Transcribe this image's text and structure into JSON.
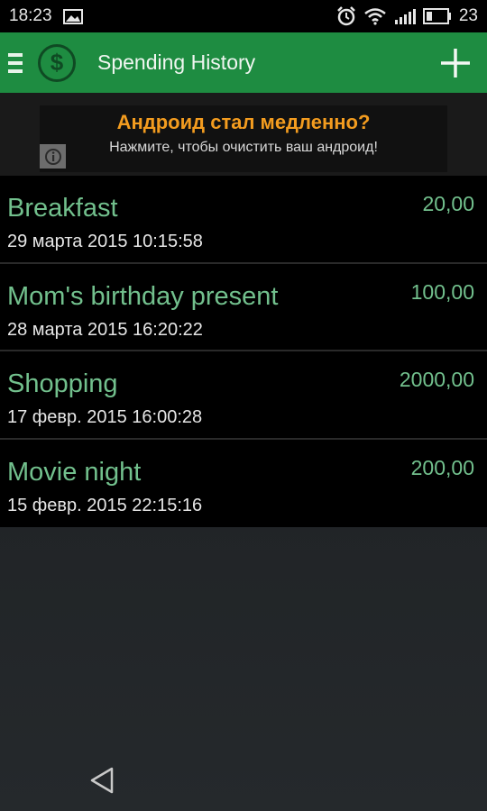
{
  "status_bar": {
    "time": "18:23",
    "battery": "23",
    "icons": [
      "image-icon",
      "alarm-icon",
      "wifi-icon",
      "signal-icon",
      "battery-icon"
    ]
  },
  "app_bar": {
    "logo_symbol": "$",
    "title": "Spending History",
    "accent_color": "#1e8c41"
  },
  "ad": {
    "title": "Андроид стал медленно?",
    "subtitle": "Нажмите, чтобы очистить ваш андроид!"
  },
  "spendings": [
    {
      "title": "Breakfast",
      "date": "29 марта 2015 10:15:58",
      "amount": "20,00"
    },
    {
      "title": "Mom's birthday present",
      "date": "28 марта 2015 16:20:22",
      "amount": "100,00"
    },
    {
      "title": "Shopping",
      "date": "17 февр. 2015 16:00:28",
      "amount": "2000,00"
    },
    {
      "title": "Movie night",
      "date": "15 февр. 2015 22:15:16",
      "amount": "200,00"
    }
  ]
}
